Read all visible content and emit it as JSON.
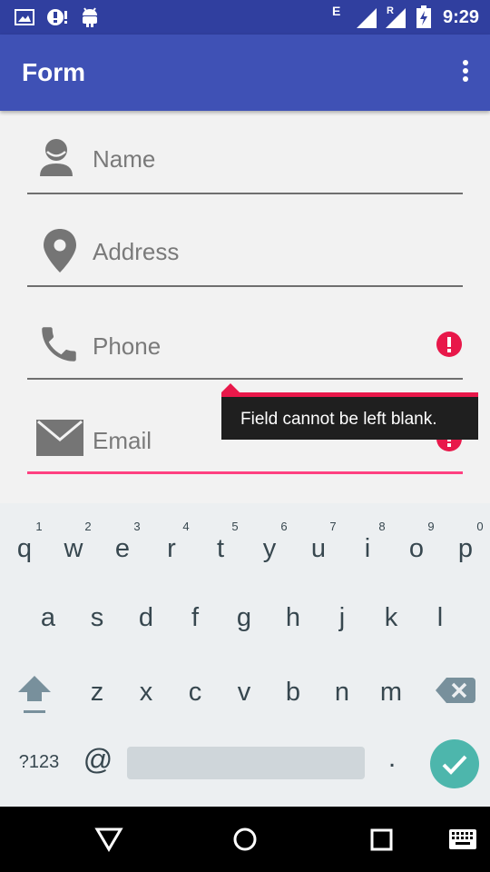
{
  "status_bar": {
    "time": "9:29",
    "network_label": "E",
    "roaming_label": "R",
    "icons": [
      "photo-icon",
      "notification-alert-icon",
      "android-icon",
      "signal-icon",
      "signal-roaming-icon",
      "battery-charging-icon"
    ]
  },
  "app_bar": {
    "title": "Form",
    "menu_icon": "more-vert-icon"
  },
  "form": {
    "fields": [
      {
        "label": "Name",
        "icon": "person-icon",
        "error": false
      },
      {
        "label": "Address",
        "icon": "location-pin-icon",
        "error": false
      },
      {
        "label": "Phone",
        "icon": "phone-icon",
        "error": true
      },
      {
        "label": "Email",
        "icon": "email-icon",
        "error": true,
        "focused": true
      }
    ],
    "error_message": "Field cannot be left blank."
  },
  "keyboard": {
    "row1": [
      {
        "char": "q",
        "hint": "1"
      },
      {
        "char": "w",
        "hint": "2"
      },
      {
        "char": "e",
        "hint": "3"
      },
      {
        "char": "r",
        "hint": "4"
      },
      {
        "char": "t",
        "hint": "5"
      },
      {
        "char": "y",
        "hint": "6"
      },
      {
        "char": "u",
        "hint": "7"
      },
      {
        "char": "i",
        "hint": "8"
      },
      {
        "char": "o",
        "hint": "9"
      },
      {
        "char": "p",
        "hint": "0"
      }
    ],
    "row2": [
      "a",
      "s",
      "d",
      "f",
      "g",
      "h",
      "j",
      "k",
      "l"
    ],
    "row3": [
      "z",
      "x",
      "c",
      "v",
      "b",
      "n",
      "m"
    ],
    "symbols_label": "?123",
    "at_label": "@",
    "period_label": ".",
    "shift_icon": "shift-icon",
    "backspace_icon": "backspace-icon",
    "done_icon": "check-icon"
  },
  "nav_bar": {
    "icons": [
      "back-icon",
      "home-icon",
      "recents-icon",
      "keyboard-icon"
    ]
  },
  "colors": {
    "status_bar": "#303f9f",
    "app_bar": "#3f51b5",
    "accent": "#ff4081",
    "error": "#e8184a",
    "done_key": "#4db6ac"
  }
}
